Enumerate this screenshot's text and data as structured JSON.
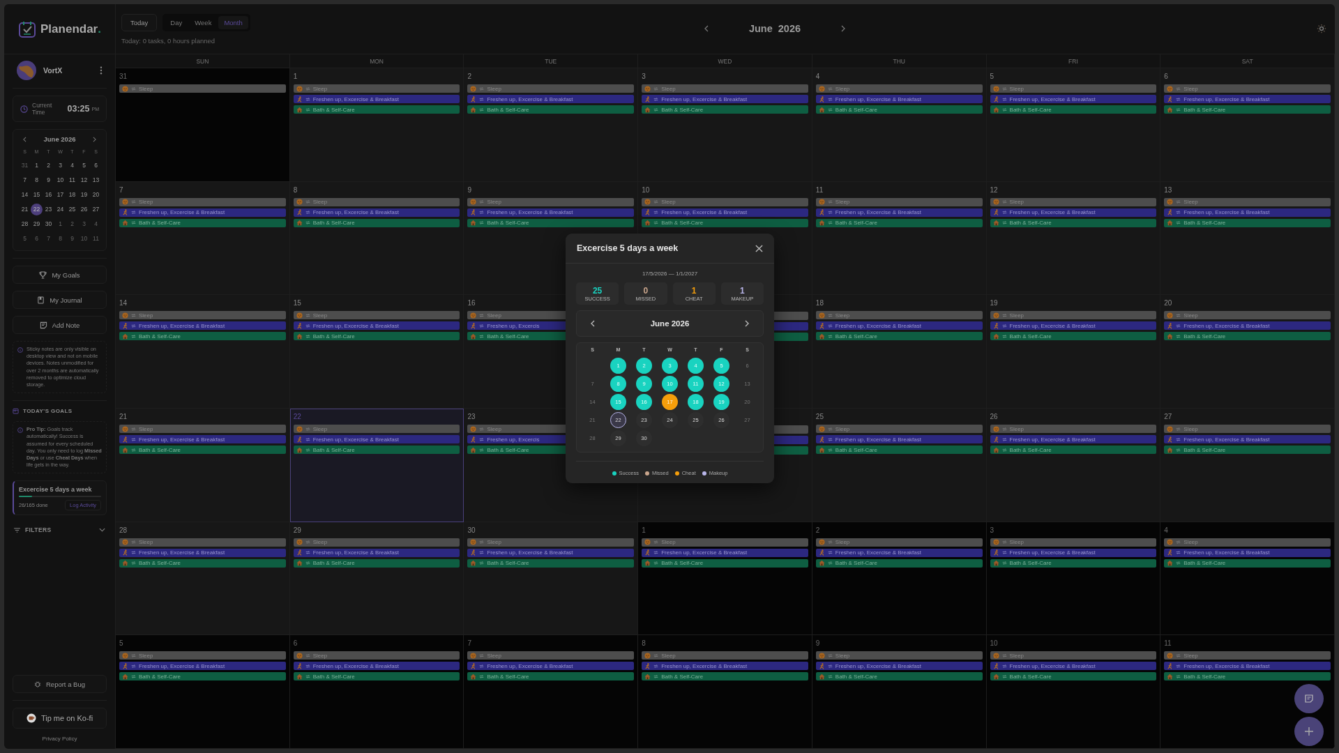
{
  "brand": {
    "name": "Planendar",
    "accent": "."
  },
  "user": {
    "name": "VortX"
  },
  "clock": {
    "label": "Current Time",
    "time": "03:25",
    "period": "PM"
  },
  "mini_calendar": {
    "title": "June 2026",
    "weekdays": [
      "S",
      "M",
      "T",
      "W",
      "T",
      "F",
      "S"
    ],
    "weeks": [
      [
        {
          "day": "31",
          "muted": true,
          "today": false
        },
        {
          "day": "1",
          "muted": false,
          "today": false
        },
        {
          "day": "2",
          "muted": false,
          "today": false
        },
        {
          "day": "3",
          "muted": false,
          "today": false
        },
        {
          "day": "4",
          "muted": false,
          "today": false
        },
        {
          "day": "5",
          "muted": false,
          "today": false
        },
        {
          "day": "6",
          "muted": false,
          "today": false
        }
      ],
      [
        {
          "day": "7",
          "muted": false,
          "today": false
        },
        {
          "day": "8",
          "muted": false,
          "today": false
        },
        {
          "day": "9",
          "muted": false,
          "today": false
        },
        {
          "day": "10",
          "muted": false,
          "today": false
        },
        {
          "day": "11",
          "muted": false,
          "today": false
        },
        {
          "day": "12",
          "muted": false,
          "today": false
        },
        {
          "day": "13",
          "muted": false,
          "today": false
        }
      ],
      [
        {
          "day": "14",
          "muted": false,
          "today": false
        },
        {
          "day": "15",
          "muted": false,
          "today": false
        },
        {
          "day": "16",
          "muted": false,
          "today": false
        },
        {
          "day": "17",
          "muted": false,
          "today": false
        },
        {
          "day": "18",
          "muted": false,
          "today": false
        },
        {
          "day": "19",
          "muted": false,
          "today": false
        },
        {
          "day": "20",
          "muted": false,
          "today": false
        }
      ],
      [
        {
          "day": "21",
          "muted": false,
          "today": false
        },
        {
          "day": "22",
          "muted": false,
          "today": true
        },
        {
          "day": "23",
          "muted": false,
          "today": false
        },
        {
          "day": "24",
          "muted": false,
          "today": false
        },
        {
          "day": "25",
          "muted": false,
          "today": false
        },
        {
          "day": "26",
          "muted": false,
          "today": false
        },
        {
          "day": "27",
          "muted": false,
          "today": false
        }
      ],
      [
        {
          "day": "28",
          "muted": false,
          "today": false
        },
        {
          "day": "29",
          "muted": false,
          "today": false
        },
        {
          "day": "30",
          "muted": false,
          "today": false
        },
        {
          "day": "1",
          "muted": true,
          "today": false
        },
        {
          "day": "2",
          "muted": true,
          "today": false
        },
        {
          "day": "3",
          "muted": true,
          "today": false
        },
        {
          "day": "4",
          "muted": true,
          "today": false
        }
      ],
      [
        {
          "day": "5",
          "muted": true,
          "today": false
        },
        {
          "day": "6",
          "muted": true,
          "today": false
        },
        {
          "day": "7",
          "muted": true,
          "today": false
        },
        {
          "day": "8",
          "muted": true,
          "today": false
        },
        {
          "day": "9",
          "muted": true,
          "today": false
        },
        {
          "day": "10",
          "muted": true,
          "today": false
        },
        {
          "day": "11",
          "muted": true,
          "today": false
        }
      ]
    ]
  },
  "nav_buttons": [
    {
      "kind": "goals",
      "label": "My Goals"
    },
    {
      "kind": "journal",
      "label": "My Journal"
    },
    {
      "kind": "note",
      "label": "Add Note"
    }
  ],
  "sticky_notice": "Sticky notes are only visible on desktop view and not on mobile devices. Notes unmodified for over 2 months are automatically removed to optimize cloud storage.",
  "todays_goals": {
    "heading": "TODAY’S GOALS",
    "tip": "**Pro Tip:** Goals track automatically! Success is assumed for every scheduled day. You only need to log **Missed Days** or use **Cheat Days** when life gets in the way.",
    "goal": {
      "title": "Excercise 5 days a week",
      "level": 0.158,
      "progress": "26/165 done",
      "action": "Log Activity"
    }
  },
  "filters": {
    "label": "FILTERS",
    "expanded": false
  },
  "report_bug": "Report a Bug",
  "kofi": "Tip me on Ko-fi",
  "privacy": "Privacy Policy",
  "toolbar": {
    "today": "Today",
    "views": [
      {
        "label": "Day",
        "selected": false
      },
      {
        "label": "Week",
        "selected": false
      },
      {
        "label": "Month",
        "selected": true
      }
    ],
    "summary": "Today: 0 tasks, 0 hours planned",
    "month": "June  2026"
  },
  "calendar": {
    "weekdays": [
      "SUN",
      "MON",
      "TUE",
      "WED",
      "THU",
      "FRI",
      "SAT"
    ],
    "weeks": [
      [
        {
          "day": "31",
          "muted": true,
          "today": false,
          "events": [
            {
              "kind": "sleep",
              "title": "Sleep"
            }
          ]
        },
        {
          "day": "1",
          "muted": false,
          "today": false,
          "events": [
            {
              "kind": "sleep",
              "title": "Sleep"
            },
            {
              "kind": "exercise",
              "title": "Freshen up, Excercise & Breakfast"
            },
            {
              "kind": "bath",
              "title": "Bath & Self-Care"
            }
          ]
        },
        {
          "day": "2",
          "muted": false,
          "today": false,
          "events": [
            {
              "kind": "sleep",
              "title": "Sleep"
            },
            {
              "kind": "exercise",
              "title": "Freshen up, Excercise & Breakfast"
            },
            {
              "kind": "bath",
              "title": "Bath & Self-Care"
            }
          ]
        },
        {
          "day": "3",
          "muted": false,
          "today": false,
          "events": [
            {
              "kind": "sleep",
              "title": "Sleep"
            },
            {
              "kind": "exercise",
              "title": "Freshen up, Excercise & Breakfast"
            },
            {
              "kind": "bath",
              "title": "Bath & Self-Care"
            }
          ]
        },
        {
          "day": "4",
          "muted": false,
          "today": false,
          "events": [
            {
              "kind": "sleep",
              "title": "Sleep"
            },
            {
              "kind": "exercise",
              "title": "Freshen up, Excercise & Breakfast"
            },
            {
              "kind": "bath",
              "title": "Bath & Self-Care"
            }
          ]
        },
        {
          "day": "5",
          "muted": false,
          "today": false,
          "events": [
            {
              "kind": "sleep",
              "title": "Sleep"
            },
            {
              "kind": "exercise",
              "title": "Freshen up, Excercise & Breakfast"
            },
            {
              "kind": "bath",
              "title": "Bath & Self-Care"
            }
          ]
        },
        {
          "day": "6",
          "muted": false,
          "today": false,
          "events": [
            {
              "kind": "sleep",
              "title": "Sleep"
            },
            {
              "kind": "exercise",
              "title": "Freshen up, Excercise & Breakfast"
            },
            {
              "kind": "bath",
              "title": "Bath & Self-Care"
            }
          ]
        }
      ],
      [
        {
          "day": "7",
          "muted": false,
          "today": false,
          "events": [
            {
              "kind": "sleep",
              "title": "Sleep"
            },
            {
              "kind": "exercise",
              "title": "Freshen up, Excercise & Breakfast"
            },
            {
              "kind": "bath",
              "title": "Bath & Self-Care"
            }
          ]
        },
        {
          "day": "8",
          "muted": false,
          "today": false,
          "events": [
            {
              "kind": "sleep",
              "title": "Sleep"
            },
            {
              "kind": "exercise",
              "title": "Freshen up, Excercise & Breakfast"
            },
            {
              "kind": "bath",
              "title": "Bath & Self-Care"
            }
          ]
        },
        {
          "day": "9",
          "muted": false,
          "today": false,
          "events": [
            {
              "kind": "sleep",
              "title": "Sleep"
            },
            {
              "kind": "exercise",
              "title": "Freshen up, Excercise & Breakfast"
            },
            {
              "kind": "bath",
              "title": "Bath & Self-Care"
            }
          ]
        },
        {
          "day": "10",
          "muted": false,
          "today": false,
          "events": [
            {
              "kind": "sleep",
              "title": "Sleep"
            },
            {
              "kind": "exercise",
              "title": "Freshen up, Excercise & Breakfast"
            },
            {
              "kind": "bath",
              "title": "Bath & Self-Care"
            }
          ]
        },
        {
          "day": "11",
          "muted": false,
          "today": false,
          "events": [
            {
              "kind": "sleep",
              "title": "Sleep"
            },
            {
              "kind": "exercise",
              "title": "Freshen up, Excercise & Breakfast"
            },
            {
              "kind": "bath",
              "title": "Bath & Self-Care"
            }
          ]
        },
        {
          "day": "12",
          "muted": false,
          "today": false,
          "events": [
            {
              "kind": "sleep",
              "title": "Sleep"
            },
            {
              "kind": "exercise",
              "title": "Freshen up, Excercise & Breakfast"
            },
            {
              "kind": "bath",
              "title": "Bath & Self-Care"
            }
          ]
        },
        {
          "day": "13",
          "muted": false,
          "today": false,
          "events": [
            {
              "kind": "sleep",
              "title": "Sleep"
            },
            {
              "kind": "exercise",
              "title": "Freshen up, Excercise & Breakfast"
            },
            {
              "kind": "bath",
              "title": "Bath & Self-Care"
            }
          ]
        }
      ],
      [
        {
          "day": "14",
          "muted": false,
          "today": false,
          "events": [
            {
              "kind": "sleep",
              "title": "Sleep"
            },
            {
              "kind": "exercise",
              "title": "Freshen up, Excercise & Breakfast"
            },
            {
              "kind": "bath",
              "title": "Bath & Self-Care"
            }
          ]
        },
        {
          "day": "15",
          "muted": false,
          "today": false,
          "events": [
            {
              "kind": "sleep",
              "title": "Sleep"
            },
            {
              "kind": "exercise",
              "title": "Freshen up, Excercise & Breakfast"
            },
            {
              "kind": "bath",
              "title": "Bath & Self-Care"
            }
          ]
        },
        {
          "day": "16",
          "muted": false,
          "today": false,
          "events": [
            {
              "kind": "sleep",
              "title": "Sleep"
            },
            {
              "kind": "exercise",
              "title": "Freshen up, Excercis"
            },
            {
              "kind": "bath",
              "title": "Bath & Self-Care"
            }
          ]
        },
        {
          "muted": false,
          "today": false,
          "events": [
            {
              "kind": "sleep"
            },
            {
              "kind": "exercise"
            },
            {
              "kind": "bath"
            }
          ]
        },
        {
          "day": "18",
          "muted": false,
          "today": false,
          "events": [
            {
              "kind": "sleep",
              "title": "Sleep"
            },
            {
              "kind": "exercise",
              "title": "Freshen up, Excercise & Breakfast"
            },
            {
              "kind": "bath",
              "title": "Bath & Self-Care"
            }
          ]
        },
        {
          "day": "19",
          "muted": false,
          "today": false,
          "events": [
            {
              "kind": "sleep",
              "title": "Sleep"
            },
            {
              "kind": "exercise",
              "title": "Freshen up, Excercise & Breakfast"
            },
            {
              "kind": "bath",
              "title": "Bath & Self-Care"
            }
          ]
        },
        {
          "day": "20",
          "muted": false,
          "today": false,
          "events": [
            {
              "kind": "sleep",
              "title": "Sleep"
            },
            {
              "kind": "exercise",
              "title": "Freshen up, Excercise & Breakfast"
            },
            {
              "kind": "bath",
              "title": "Bath & Self-Care"
            }
          ]
        }
      ],
      [
        {
          "day": "21",
          "muted": false,
          "today": false,
          "events": [
            {
              "kind": "sleep",
              "title": "Sleep"
            },
            {
              "kind": "exercise",
              "title": "Freshen up, Excercise & Breakfast"
            },
            {
              "kind": "bath",
              "title": "Bath & Self-Care"
            }
          ]
        },
        {
          "day": "22",
          "muted": false,
          "today": true,
          "events": [
            {
              "kind": "sleep",
              "title": "Sleep"
            },
            {
              "kind": "exercise",
              "title": "Freshen up, Excercise & Breakfast"
            },
            {
              "kind": "bath",
              "title": "Bath & Self-Care"
            }
          ]
        },
        {
          "day": "23",
          "muted": false,
          "today": false,
          "events": [
            {
              "kind": "sleep",
              "title": "Sleep"
            },
            {
              "kind": "exercise",
              "title": "Freshen up, Excercis"
            },
            {
              "kind": "bath",
              "title": "Bath & Self-Care"
            }
          ]
        },
        {
          "muted": false,
          "today": false,
          "events": [
            {
              "kind": "sleep"
            },
            {
              "kind": "exercise"
            },
            {
              "kind": "bath"
            }
          ]
        },
        {
          "day": "25",
          "muted": false,
          "today": false,
          "events": [
            {
              "kind": "sleep",
              "title": "Sleep"
            },
            {
              "kind": "exercise",
              "title": "Freshen up, Excercise & Breakfast"
            },
            {
              "kind": "bath",
              "title": "Bath & Self-Care"
            }
          ]
        },
        {
          "day": "26",
          "muted": false,
          "today": false,
          "events": [
            {
              "kind": "sleep",
              "title": "Sleep"
            },
            {
              "kind": "exercise",
              "title": "Freshen up, Excercise & Breakfast"
            },
            {
              "kind": "bath",
              "title": "Bath & Self-Care"
            }
          ]
        },
        {
          "day": "27",
          "muted": false,
          "today": false,
          "events": [
            {
              "kind": "sleep",
              "title": "Sleep"
            },
            {
              "kind": "exercise",
              "title": "Freshen up, Excercise & Breakfast"
            },
            {
              "kind": "bath",
              "title": "Bath & Self-Care"
            }
          ]
        }
      ],
      [
        {
          "day": "28",
          "muted": false,
          "today": false,
          "events": [
            {
              "kind": "sleep",
              "title": "Sleep"
            },
            {
              "kind": "exercise",
              "title": "Freshen up, Excercise & Breakfast"
            },
            {
              "kind": "bath",
              "title": "Bath & Self-Care"
            }
          ]
        },
        {
          "day": "29",
          "muted": false,
          "today": false,
          "events": [
            {
              "kind": "sleep",
              "title": "Sleep"
            },
            {
              "kind": "exercise",
              "title": "Freshen up, Excercise & Breakfast"
            },
            {
              "kind": "bath",
              "title": "Bath & Self-Care"
            }
          ]
        },
        {
          "day": "30",
          "muted": false,
          "today": false,
          "events": [
            {
              "kind": "sleep",
              "title": "Sleep"
            },
            {
              "kind": "exercise",
              "title": "Freshen up, Excercise & Breakfast"
            },
            {
              "kind": "bath",
              "title": "Bath & Self-Care"
            }
          ]
        },
        {
          "day": "1",
          "muted": true,
          "today": false,
          "events": [
            {
              "kind": "sleep",
              "title": "Sleep"
            },
            {
              "kind": "exercise",
              "title": "Freshen up, Excercise & Breakfast"
            },
            {
              "kind": "bath",
              "title": "Bath & Self-Care"
            }
          ]
        },
        {
          "day": "2",
          "muted": true,
          "today": false,
          "events": [
            {
              "kind": "sleep",
              "title": "Sleep"
            },
            {
              "kind": "exercise",
              "title": "Freshen up, Excercise & Breakfast"
            },
            {
              "kind": "bath",
              "title": "Bath & Self-Care"
            }
          ]
        },
        {
          "day": "3",
          "muted": true,
          "today": false,
          "events": [
            {
              "kind": "sleep",
              "title": "Sleep"
            },
            {
              "kind": "exercise",
              "title": "Freshen up, Excercise & Breakfast"
            },
            {
              "kind": "bath",
              "title": "Bath & Self-Care"
            }
          ]
        },
        {
          "day": "4",
          "muted": true,
          "today": false,
          "events": [
            {
              "kind": "sleep",
              "title": "Sleep"
            },
            {
              "kind": "exercise",
              "title": "Freshen up, Excercise & Breakfast"
            },
            {
              "kind": "bath",
              "title": "Bath & Self-Care"
            }
          ]
        }
      ],
      [
        {
          "day": "5",
          "muted": true,
          "today": false,
          "events": [
            {
              "kind": "sleep",
              "title": "Sleep"
            },
            {
              "kind": "exercise",
              "title": "Freshen up, Excercise & Breakfast"
            },
            {
              "kind": "bath",
              "title": "Bath & Self-Care"
            }
          ]
        },
        {
          "day": "6",
          "muted": true,
          "today": false,
          "events": [
            {
              "kind": "sleep",
              "title": "Sleep"
            },
            {
              "kind": "exercise",
              "title": "Freshen up, Excercise & Breakfast"
            },
            {
              "kind": "bath",
              "title": "Bath & Self-Care"
            }
          ]
        },
        {
          "day": "7",
          "muted": true,
          "today": false,
          "events": [
            {
              "kind": "sleep",
              "title": "Sleep"
            },
            {
              "kind": "exercise",
              "title": "Freshen up, Excercise & Breakfast"
            },
            {
              "kind": "bath",
              "title": "Bath & Self-Care"
            }
          ]
        },
        {
          "day": "8",
          "muted": true,
          "today": false,
          "events": [
            {
              "kind": "sleep",
              "title": "Sleep"
            },
            {
              "kind": "exercise",
              "title": "Freshen up, Excercise & Breakfast"
            },
            {
              "kind": "bath",
              "title": "Bath & Self-Care"
            }
          ]
        },
        {
          "day": "9",
          "muted": true,
          "today": false,
          "events": [
            {
              "kind": "sleep",
              "title": "Sleep"
            },
            {
              "kind": "exercise",
              "title": "Freshen up, Excercise & Breakfast"
            },
            {
              "kind": "bath",
              "title": "Bath & Self-Care"
            }
          ]
        },
        {
          "day": "10",
          "muted": true,
          "today": false,
          "events": [
            {
              "kind": "sleep",
              "title": "Sleep"
            },
            {
              "kind": "exercise",
              "title": "Freshen up, Excercise & Breakfast"
            },
            {
              "kind": "bath",
              "title": "Bath & Self-Care"
            }
          ]
        },
        {
          "day": "11",
          "muted": true,
          "today": false,
          "events": [
            {
              "kind": "sleep",
              "title": "Sleep"
            },
            {
              "kind": "exercise",
              "title": "Freshen up, Excercise & Breakfast"
            },
            {
              "kind": "bath",
              "title": "Bath & Self-Care"
            }
          ]
        }
      ]
    ]
  },
  "modal": {
    "title": "Excercise 5 days a week",
    "range": "17/5/2026 — 1/1/2027",
    "stats": [
      {
        "value": "25",
        "label": "SUCCESS",
        "color": "#19d3c0"
      },
      {
        "value": "0",
        "label": "MISSED",
        "color": "#c9a58c"
      },
      {
        "value": "1",
        "label": "CHEAT",
        "color": "#f59e0b"
      },
      {
        "value": "1",
        "label": "MAKEUP",
        "color": "#b9b6ea"
      }
    ],
    "month": "June 2026",
    "weekdays": [
      "S",
      "M",
      "T",
      "W",
      "T",
      "F",
      "S"
    ],
    "weeks": [
      [
        {
          "kind": "blank"
        },
        {
          "day": "1",
          "kind": "success"
        },
        {
          "day": "2",
          "kind": "success"
        },
        {
          "day": "3",
          "kind": "success"
        },
        {
          "day": "4",
          "kind": "success"
        },
        {
          "day": "5",
          "kind": "success"
        },
        {
          "day": "6",
          "kind": "off"
        }
      ],
      [
        {
          "day": "7",
          "kind": "off"
        },
        {
          "day": "8",
          "kind": "success"
        },
        {
          "day": "9",
          "kind": "success"
        },
        {
          "day": "10",
          "kind": "success"
        },
        {
          "day": "11",
          "kind": "success"
        },
        {
          "day": "12",
          "kind": "success"
        },
        {
          "day": "13",
          "kind": "off"
        }
      ],
      [
        {
          "day": "14",
          "kind": "off"
        },
        {
          "day": "15",
          "kind": "success"
        },
        {
          "day": "16",
          "kind": "success"
        },
        {
          "day": "17",
          "kind": "cheat"
        },
        {
          "day": "18",
          "kind": "success"
        },
        {
          "day": "19",
          "kind": "success"
        },
        {
          "day": "20",
          "kind": "off"
        }
      ],
      [
        {
          "day": "21",
          "kind": "off"
        },
        {
          "day": "22",
          "kind": "today"
        },
        {
          "day": "23",
          "kind": "pending"
        },
        {
          "day": "24",
          "kind": "pending"
        },
        {
          "day": "25",
          "kind": "pending"
        },
        {
          "day": "26",
          "kind": "pending"
        },
        {
          "day": "27",
          "kind": "off"
        }
      ],
      [
        {
          "day": "28",
          "kind": "off"
        },
        {
          "day": "29",
          "kind": "pending"
        },
        {
          "day": "30",
          "kind": "pending"
        }
      ]
    ],
    "legend": [
      {
        "label": "Success",
        "color": "#19d3c0"
      },
      {
        "label": "Missed",
        "color": "#c9a58c"
      },
      {
        "label": "Cheat",
        "color": "#f59e0b"
      },
      {
        "label": "Makeup",
        "color": "#b9b6ea"
      }
    ]
  }
}
